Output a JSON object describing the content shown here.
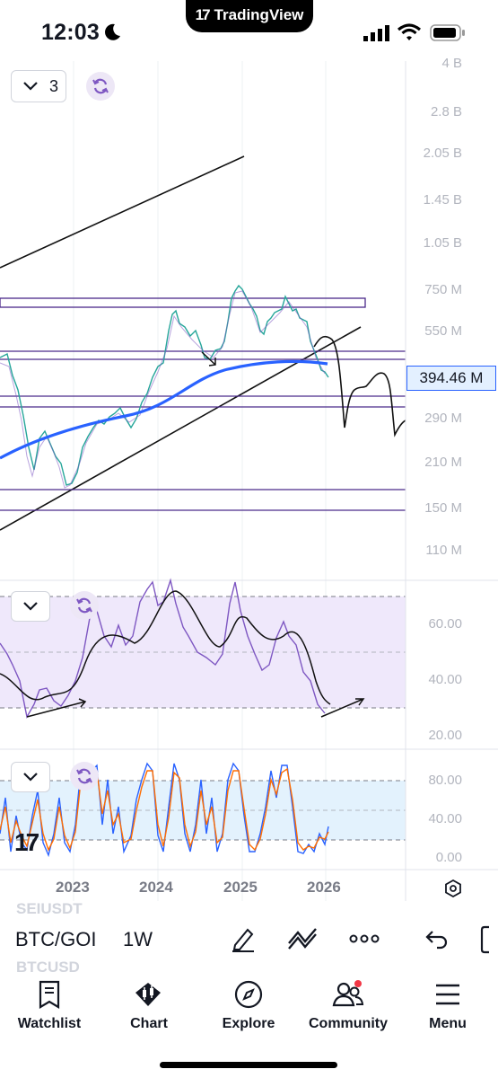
{
  "status": {
    "time": "12:03"
  },
  "island": {
    "brand": "TradingView"
  },
  "main_chart": {
    "indicator_count": "3",
    "price_label": "394.46 M",
    "scale": [
      "4 B",
      "2.8 B",
      "2.05 B",
      "1.45 B",
      "1.05 B",
      "750 M",
      "550 M",
      "290 M",
      "210 M",
      "150 M",
      "110 M"
    ]
  },
  "rsi_pane": {
    "scale": [
      "60.00",
      "40.00",
      "20.00"
    ]
  },
  "stoch_pane": {
    "scale": [
      "80.00",
      "40.00",
      "0.00"
    ]
  },
  "time_axis": {
    "labels": [
      "2023",
      "2024",
      "2025",
      "2026"
    ]
  },
  "toolbar": {
    "symbol": "BTC/GOI",
    "timeframe": "1W",
    "ghost_symbol_1": "SEIUSDT",
    "ghost_symbol_2": "BTCUSD"
  },
  "tabs": [
    {
      "label": "Watchlist",
      "icon": "watchlist-icon"
    },
    {
      "label": "Chart",
      "icon": "chart-icon"
    },
    {
      "label": "Explore",
      "icon": "compass-icon"
    },
    {
      "label": "Community",
      "icon": "community-icon"
    },
    {
      "label": "Menu",
      "icon": "menu-icon"
    }
  ],
  "colors": {
    "accent": "#2962ff",
    "rsi": "#7e57c2",
    "level_line": "#4a2a8a",
    "stoch_k": "#2962ff",
    "stoch_d": "#ff6d00",
    "rsi_band": "#efe8fb",
    "stoch_band": "#e3f2fd"
  }
}
